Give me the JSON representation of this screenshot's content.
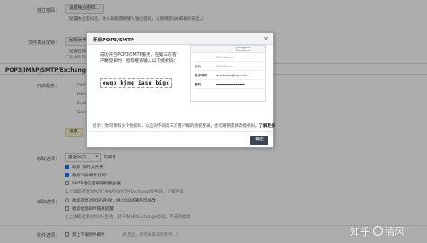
{
  "settings": {
    "independent_password": {
      "label": "独立密码：",
      "button": "设置独立密码...",
      "desc": "（设置独立密码后，进入邮箱需要输入独立密码，以保障您QQ邮箱的安全。）"
    },
    "folder_encrypt": {
      "label": "文件夹及加锁：",
      "button": "加锁文件夹...",
      "desc": "（设置后加锁文件夹需要密码才能打开。）",
      "sub": "广告书项目"
    },
    "section_title": "POP3/IMAP/SMTP/Exchange/CardDAV/CalDAV服务",
    "enable_service": {
      "label": "开启服务：",
      "rows": [
        "POP3/SMTP服务",
        "IMAP/SMTP服务",
        "Exchange服务",
        "CardDAV/CalDAV服务"
      ],
      "tip_button": "设置"
    },
    "receive_options": {
      "label": "收取选项：",
      "recent_select": "最近30天",
      "recent_suffix": "的邮件",
      "options": [
        {
          "text": "收取“我的文件夹”",
          "checked": true
        },
        {
          "text": "收取“QQ邮件订阅”",
          "checked": true
        },
        {
          "text": "SMTP发信后保存到服务器",
          "checked": false
        },
        {
          "text": "以上收取选项对POP3/IMAP/SMTP/Exchange均生效。了解更多",
          "checked": false
        }
      ]
    },
    "delivery": {
      "label": "收取选项：",
      "options": [
        "收取选项对POP3生效，进入QQ邮箱后可修改",
        "收取垃圾邮件隔离提醒",
        "以上收取选项对POP3生效；对于IMAP/Exchange协议，不支持此项"
      ]
    },
    "attachment": {
      "label": "附件选项：",
      "option": "禁止下载附件邮件",
      "desc": "（开启后，所有收取到的附件…）"
    }
  },
  "modal": {
    "title": "开启POP3/SMTP",
    "close_icon": "×",
    "instruction": "成功开启POP3/SMTP服务，在第三方客户端登录时，密码框请输入以下授权码：",
    "auth_code": "owqp kjmq iasn bigc",
    "client": {
      "tag": "QQ",
      "rows": [
        {
          "key": "",
          "value": "Mail Name"
        },
        {
          "key": "密码",
          "value": "Mail Name"
        },
        {
          "key": "电子邮件",
          "value": "mailteam@qq.com"
        },
        {
          "key": "密码",
          "value": "●●●●●●●●●●●●●●●●"
        }
      ]
    },
    "tip": "提示：你可拥有多个授权码，以应对不同第三方客户端的授权登录，也可撤销或修改授权码。",
    "more_link": "了解更多",
    "ok_button": "确定"
  },
  "watermark": {
    "left": "知乎",
    "right": "情风"
  }
}
